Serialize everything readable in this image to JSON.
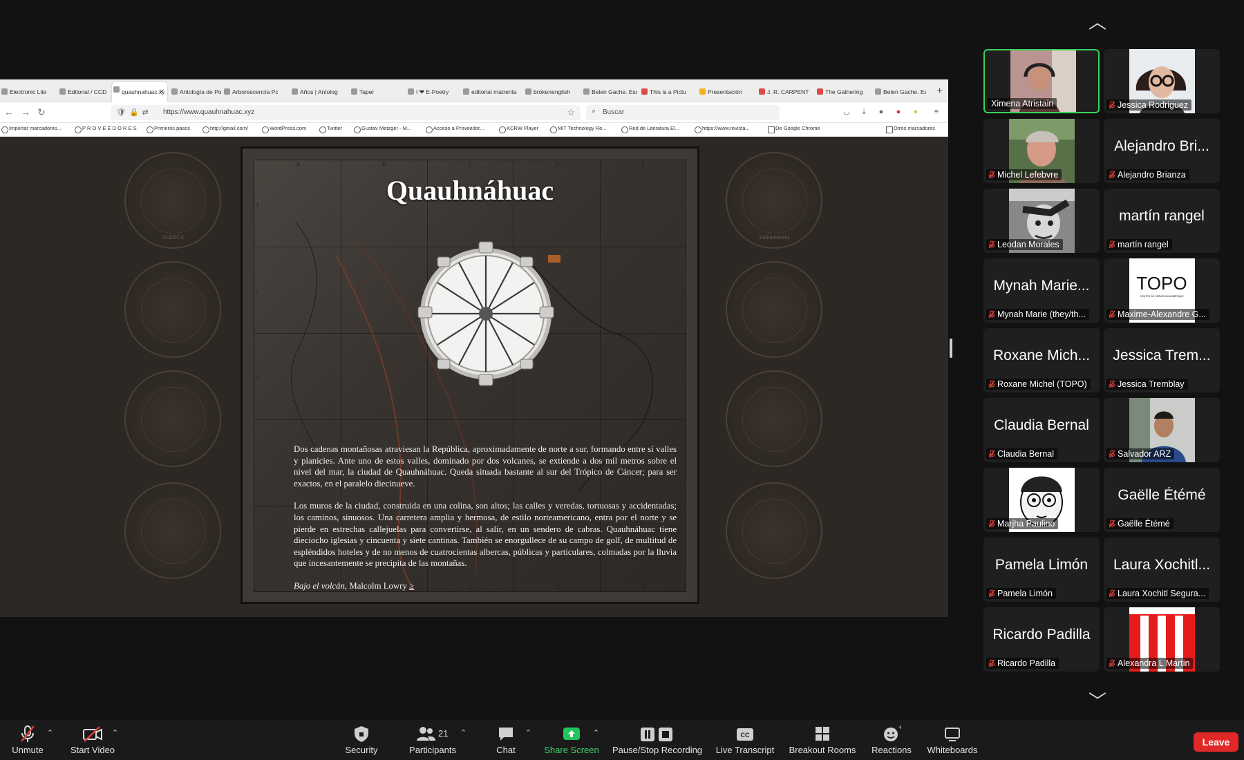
{
  "browser": {
    "tabs": [
      {
        "label": "Electronic Lite"
      },
      {
        "label": "Editorial / CCD"
      },
      {
        "label": "quauhnahuac.xy"
      },
      {
        "label": "Antología de Poes"
      },
      {
        "label": "Arborescencia Pc"
      },
      {
        "label": "Años | Antolog"
      },
      {
        "label": "Taper"
      },
      {
        "label": "I ❤ E-Poetry"
      },
      {
        "label": "editorial matrerita"
      },
      {
        "label": "brokenenglish"
      },
      {
        "label": "Belen Gache. Esc"
      },
      {
        "label": "This is a Pictu"
      },
      {
        "label": "Presentación"
      },
      {
        "label": "J. R. CARPENT"
      },
      {
        "label": "The Gathering"
      },
      {
        "label": "Belen Gache. Esc"
      }
    ],
    "url": "https://www.quauhnahuac.xyz",
    "search_placeholder": "Buscar",
    "bookmarks": [
      "Importar marcadores...",
      "P R O V E E D O R E S",
      "Primeros pasos",
      "http://gmail.com/",
      "WordPress.com",
      "Twitter",
      "Gustav Metzger - M...",
      "Acceso a Proveedor...",
      "KCRW Player",
      "MIT Technology Re...",
      "Red de Literatura El...",
      "https://www.revista...",
      "De Google Chrome"
    ],
    "other_bookmarks": "Otros marcadores"
  },
  "page": {
    "title": "Quauhnáhuac",
    "medal_labels": {
      "left1": "ACERCA",
      "right1": "Indumentaria"
    },
    "map_letters_top": [
      "A",
      "B",
      "C",
      "D",
      "E"
    ],
    "map_numbers_side": [
      "1",
      "2",
      "3"
    ],
    "paragraph1": "Dos cadenas montañosas atraviesan la República, aproximadamente de norte a sur, formando entre sí valles y planicies. Ante uno de estos valles, dominado por dos volcanes, se extiende a dos mil metros sobre el nivel del mar, la ciudad de Quauhnáhuac. Queda situada bastante al sur del Trópico de Cáncer; para ser exactos, en el paralelo diecinueve.",
    "paragraph2": "Los muros de la ciudad, construida en una colina, son altos; las calles y veredas, tortuosas y accidentadas; los caminos, sinuosos. Una carretera amplia y hermosa, de estilo norteamericano, entra por el norte y se pierde en estrechas callejuelas para convertirse, al salir, en un sendero de cabras. Quauhnáhuac tiene dieciocho iglesias y cincuenta y siete cantinas. También se enorgullece de su campo de golf, de multitud de espléndidos hoteles y de no menos de cuatrocientas albercas, públicas y particulares, colmadas por la lluvia que incesantemente se precipita de las montañas.",
    "citation_title": "Bajo el volcán",
    "citation_author": ", Malcolm Lowry",
    "citation_link": "≥"
  },
  "participants": [
    {
      "big": "",
      "label": "Ximena Atristain",
      "active": true,
      "muted": false,
      "photo": "woman-headphones"
    },
    {
      "big": "",
      "label": "Jessica Rodriguez",
      "active": false,
      "muted": true,
      "photo": "woman-glasses"
    },
    {
      "big": "",
      "label": "Michel Lefebvre",
      "active": false,
      "muted": true,
      "photo": "man-grey-hair"
    },
    {
      "big": "Alejandro Bri...",
      "label": "Alejandro Brianza",
      "active": false,
      "muted": true,
      "photo": ""
    },
    {
      "big": "",
      "label": "Leodan Morales",
      "active": false,
      "muted": true,
      "photo": "bw-face"
    },
    {
      "big": "martín rangel",
      "label": "martín rangel",
      "active": false,
      "muted": true,
      "photo": ""
    },
    {
      "big": "Mynah Marie...",
      "label": "Mynah Marie (they/th...",
      "active": false,
      "muted": true,
      "photo": ""
    },
    {
      "big": "",
      "label": "Maxime-Alexandre G...",
      "active": false,
      "muted": true,
      "photo": "topo-logo"
    },
    {
      "big": "Roxane Mich...",
      "label": "Roxane Michel (TOPO)",
      "active": false,
      "muted": true,
      "photo": ""
    },
    {
      "big": "Jessica Trem...",
      "label": "Jessica Tremblay",
      "active": false,
      "muted": true,
      "photo": ""
    },
    {
      "big": "Claudia Bernal",
      "label": "Claudia Bernal",
      "active": false,
      "muted": true,
      "photo": ""
    },
    {
      "big": "",
      "label": "Salvador ARZ",
      "active": false,
      "muted": true,
      "photo": "man-blue-shirt"
    },
    {
      "big": "",
      "label": "Marjha Paulino",
      "active": false,
      "muted": true,
      "photo": "illustrated-face"
    },
    {
      "big": "Gaëlle Étémé",
      "label": "Gaëlle Étémé",
      "active": false,
      "muted": true,
      "photo": ""
    },
    {
      "big": "Pamela Limón",
      "label": "Pamela Limón",
      "active": false,
      "muted": true,
      "photo": ""
    },
    {
      "big": "Laura Xochitl...",
      "label": "Laura Xochitl Segura...",
      "active": false,
      "muted": true,
      "photo": ""
    },
    {
      "big": "Ricardo Padilla",
      "label": "Ricardo Padilla",
      "active": false,
      "muted": true,
      "photo": ""
    },
    {
      "big": "",
      "label": "Alexandra L Martin",
      "active": false,
      "muted": true,
      "photo": "red-white-stripes"
    }
  ],
  "topo_logo_text": "TOPO",
  "topo_logo_sub": "CENTRE DE CRÉATION NUMÉRIQUE",
  "toolbar": {
    "unmute": "Unmute",
    "start_video": "Start Video",
    "security": "Security",
    "participants": "Participants",
    "participants_count": "21",
    "chat": "Chat",
    "share_screen": "Share Screen",
    "recording": "Pause/Stop Recording",
    "live_transcript": "Live Transcript",
    "breakout_rooms": "Breakout Rooms",
    "reactions": "Reactions",
    "whiteboards": "Whiteboards",
    "leave": "Leave"
  },
  "colors": {
    "share_green": "#3fd46b",
    "leave_red": "#e02828",
    "active_border": "#3bd15b",
    "muted_red": "#e0403a"
  }
}
